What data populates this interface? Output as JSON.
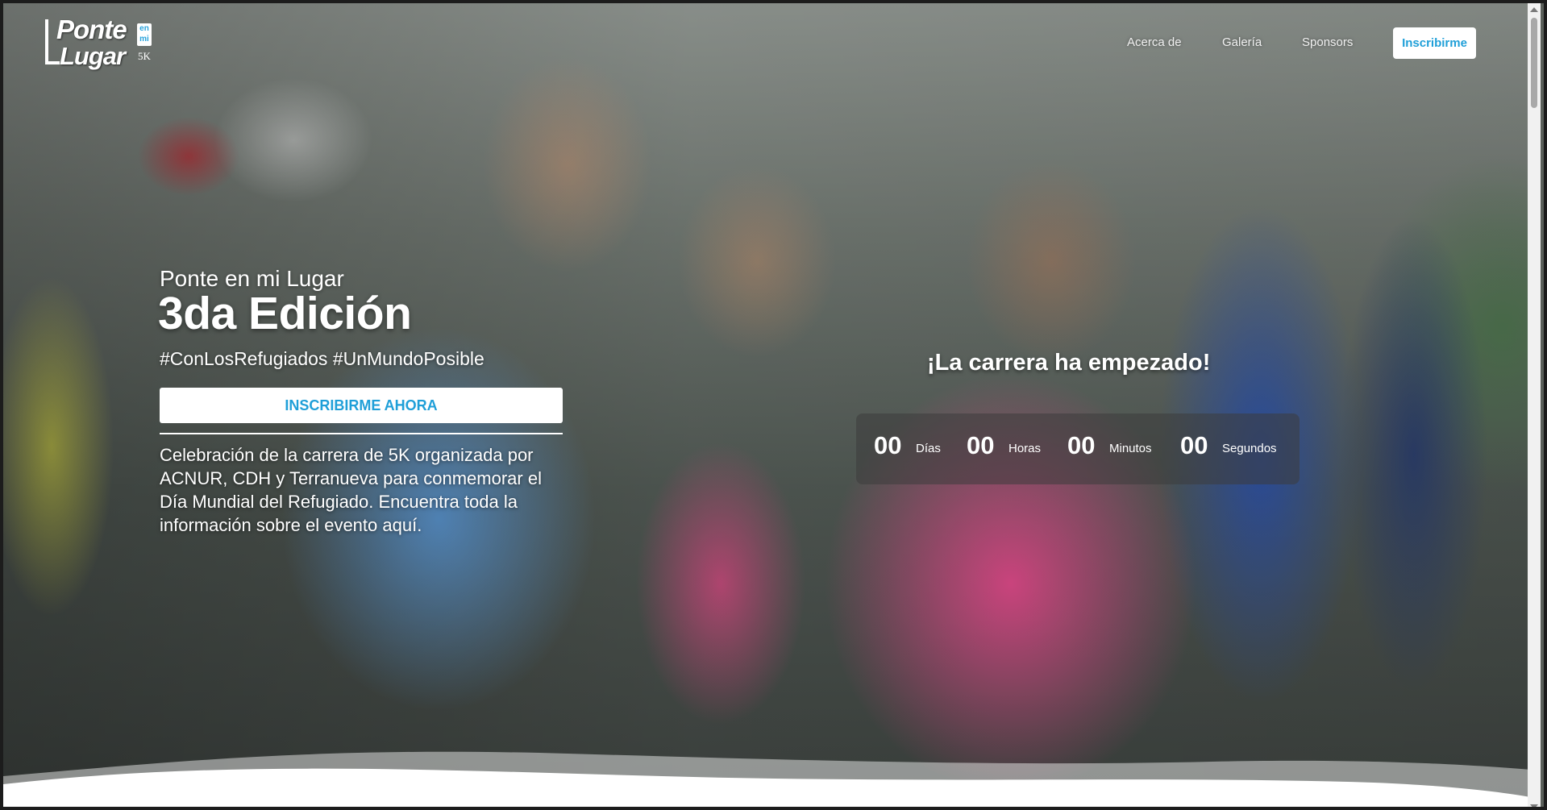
{
  "logo": {
    "line1": "Ponte",
    "line2": "Lugar",
    "en_mi": "en mi",
    "suffix": "5K"
  },
  "nav": {
    "links": [
      "Acerca de",
      "Galería",
      "Sponsors"
    ],
    "cta_label": "Inscribirme"
  },
  "hero": {
    "subtitle": "Ponte en mi Lugar",
    "title": "3da Edición",
    "hashtags": "#ConLosRefugiados #UnMundoPosible",
    "cta_label": "INSCRIBIRME AHORA",
    "description": "Celebración de la carrera de 5K organizada por ACNUR, CDH y Terranueva para conmemorar el Día Mundial del Refugiado. Encuentra toda la información sobre el evento aquí."
  },
  "countdown": {
    "status": "¡La carrera ha empezado!",
    "days_value": "00",
    "days_label": "Días",
    "hours_value": "00",
    "hours_label": "Horas",
    "minutes_value": "00",
    "minutes_label": "Minutos",
    "seconds_value": "00",
    "seconds_label": "Segundos"
  },
  "colors": {
    "accent": "#1f9fd8",
    "text_light": "#ffffff"
  }
}
